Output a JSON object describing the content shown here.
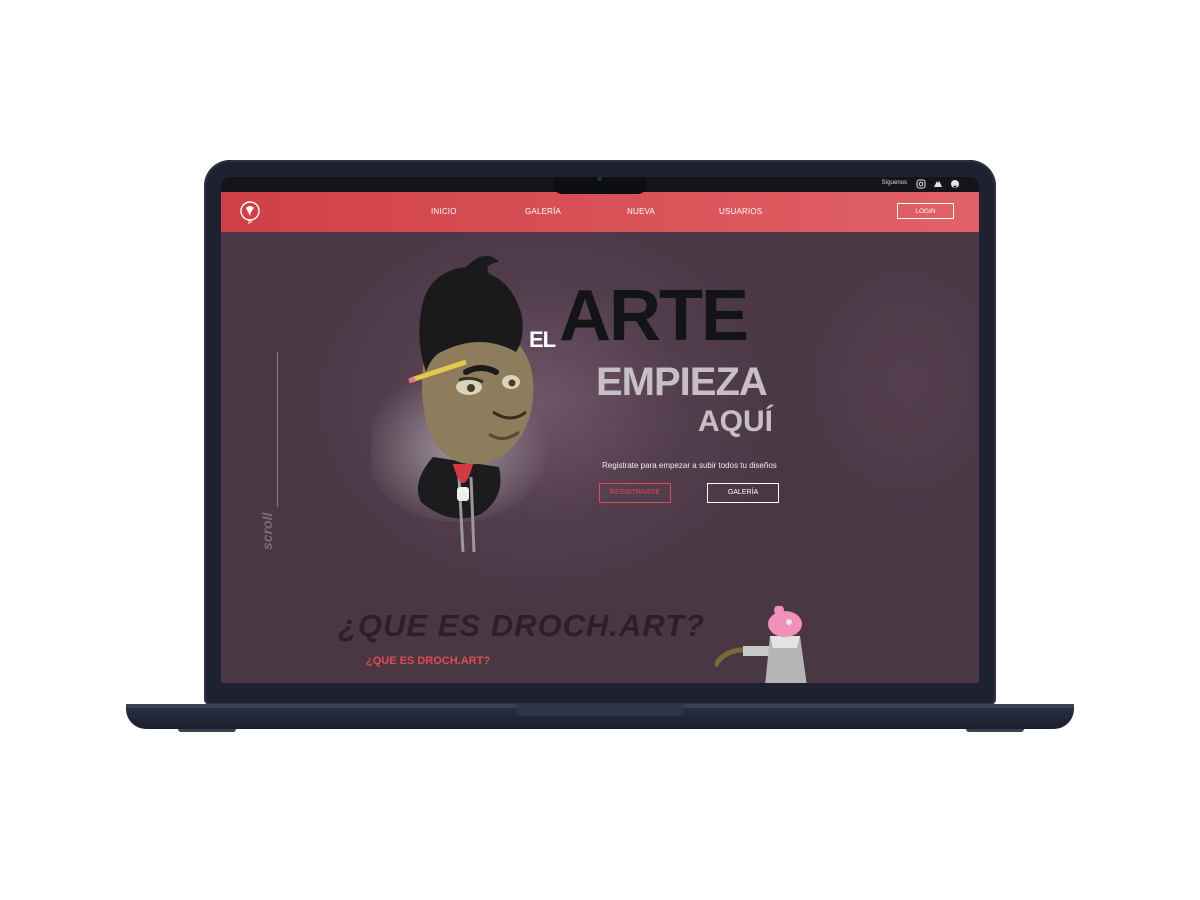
{
  "nav": {
    "follow_label": "Síguenos",
    "links": [
      "INICIO",
      "GALERÍA",
      "NUEVA",
      "USUARIOS"
    ],
    "login_label": "LOGIN",
    "social_icons": [
      "instagram-icon",
      "behance-icon",
      "github-icon"
    ]
  },
  "hero": {
    "title_el": "EL",
    "title_arte": "ARTE",
    "title_empieza": "EMPIEZA",
    "title_aqui": "AQUÍ",
    "subtitle": "Registrate para empezar a subir todos tu diseños",
    "register_label": "REGISTRARSE",
    "gallery_label": "GALERÍA",
    "scroll_label": "scroll"
  },
  "section": {
    "heading_shadow": "¿QUE ES DROCH.ART?",
    "heading": "¿QUE ES DROCH.ART?"
  },
  "colors": {
    "accent": "#e04b52",
    "nav_bg": "#d04046",
    "hero_bg": "#4a3744",
    "laptop": "#1d2130"
  }
}
